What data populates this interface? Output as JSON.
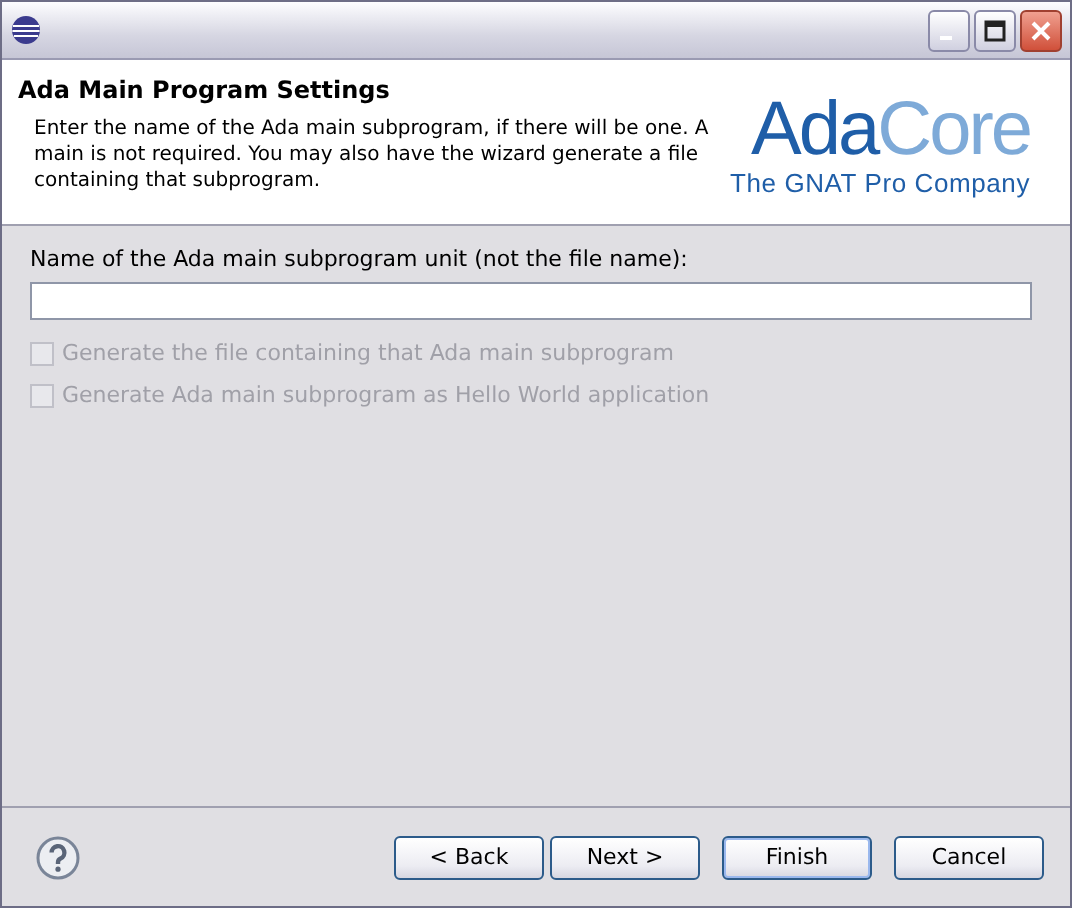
{
  "header": {
    "title": "Ada Main Program Settings",
    "description": "Enter the name of the Ada main subprogram, if there will be one. A main is not required. You may also have the wizard generate a file containing that subprogram.",
    "logo": {
      "first": "Ada",
      "second": "Core",
      "tagline": "The GNAT Pro Company"
    }
  },
  "form": {
    "field_label": "Name of the Ada main subprogram unit (not the file name):",
    "checkboxes": [
      {
        "label": "Generate the file containing that Ada main subprogram",
        "checked": false,
        "disabled": true
      },
      {
        "label": "Generate Ada main subprogram as Hello World application",
        "checked": false,
        "disabled": true
      }
    ]
  },
  "buttons": [
    {
      "label": "< Back",
      "default": false
    },
    {
      "label": "Next >",
      "default": false
    },
    {
      "label": "Finish",
      "default": true
    },
    {
      "label": "Cancel",
      "default": false
    }
  ]
}
